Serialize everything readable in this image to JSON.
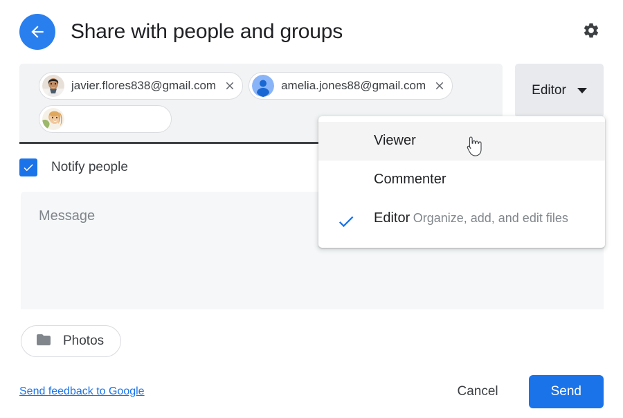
{
  "header": {
    "title": "Share with people and groups",
    "back_icon": "arrow-left-icon",
    "settings_icon": "gear-icon"
  },
  "share_input": {
    "chips": [
      {
        "email": "javier.flores838@gmail.com",
        "avatar_type": "photo-male",
        "close_icon": "close-icon"
      },
      {
        "email": "amelia.jones88@gmail.com",
        "avatar_type": "default-person",
        "close_icon": "close-icon"
      },
      {
        "email": "",
        "avatar_type": "photo-female",
        "close_icon": "close-icon"
      }
    ]
  },
  "role_select": {
    "value": "Editor",
    "caret_icon": "chevron-down-icon",
    "options": [
      {
        "label": "Viewer",
        "description": "",
        "checked": false,
        "hovered": true
      },
      {
        "label": "Commenter",
        "description": "",
        "checked": false,
        "hovered": false
      },
      {
        "label": "Editor",
        "description": "Organize, add, and edit files",
        "checked": true,
        "hovered": false
      }
    ],
    "check_icon": "check-icon"
  },
  "notify": {
    "label": "Notify people",
    "checked": true,
    "check_icon": "check-icon"
  },
  "message": {
    "placeholder": "Message"
  },
  "folder_chip": {
    "label": "Photos",
    "icon": "folder-icon"
  },
  "footer": {
    "feedback_label": "Send feedback to Google",
    "cancel_label": "Cancel",
    "send_label": "Send"
  },
  "colors": {
    "accent_blue": "#1a73e8",
    "back_button_blue": "#2a7fee",
    "field_grey": "#f1f3f4",
    "role_button_grey": "#e8eaed",
    "text_primary": "#202124",
    "text_secondary": "#80868b"
  },
  "cursor": {
    "type": "pointing-hand"
  }
}
